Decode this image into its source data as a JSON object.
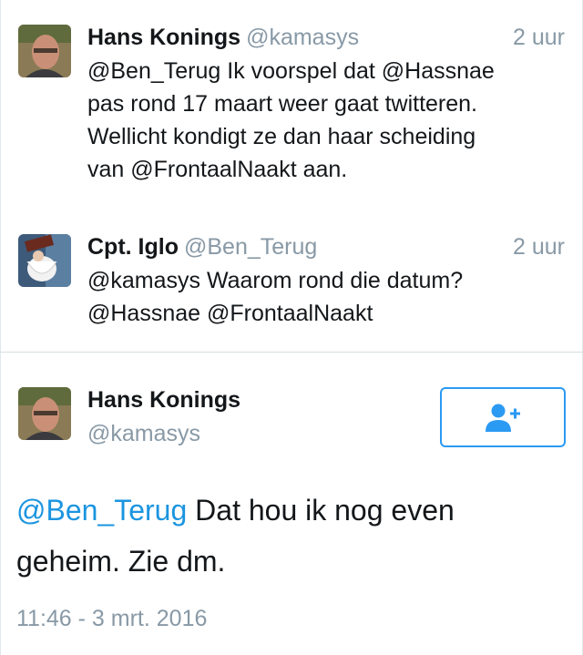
{
  "replies": [
    {
      "name": "Hans Konings",
      "handle": "@kamasys",
      "time": "2 uur",
      "lines": [
        "@Ben_Terug Ik voorspel dat @Hassnae",
        "pas rond 17 maart weer gaat twitteren.",
        "Wellicht kondigt ze dan haar scheiding",
        "van @FrontaalNaakt aan."
      ]
    },
    {
      "name": "Cpt. Iglo",
      "handle": "@Ben_Terug",
      "time": "2 uur",
      "lines": [
        "@kamasys Waarom rond die datum?",
        "@Hassnae @FrontaalNaakt"
      ]
    }
  ],
  "main_tweet": {
    "name": "Hans Konings",
    "handle": "@kamasys",
    "mention": "@Ben_Terug",
    "text_line1": " Dat hou ik nog even",
    "text_line2": "geheim. Zie dm.",
    "timestamp": "11:46 - 3 mrt. 2016",
    "follow_icon": "add-user-icon"
  },
  "colors": {
    "link": "#1b95e0",
    "muted": "#8899a6",
    "follow_border": "#2b9af3",
    "text": "#14171a"
  }
}
